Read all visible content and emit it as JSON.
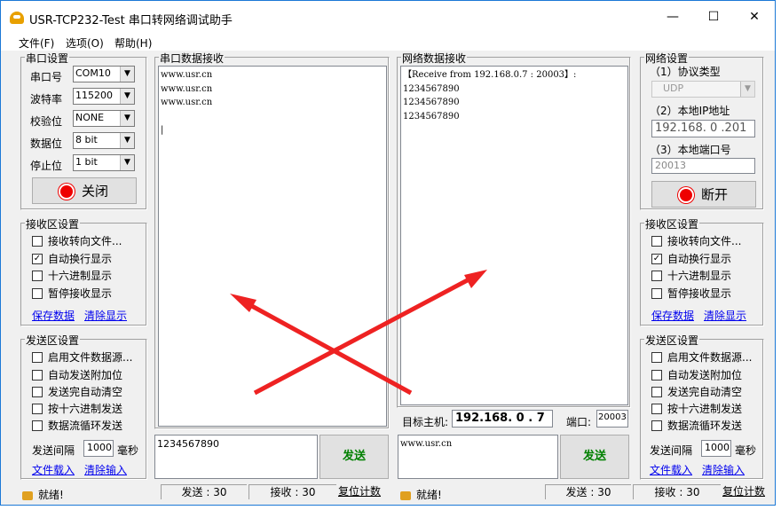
{
  "window": {
    "title": "USR-TCP232-Test 串口转网络调试助手",
    "minimize": "—",
    "maximize": "☐",
    "close": "✕"
  },
  "menu": [
    "文件(F)",
    "选项(O)",
    "帮助(H)"
  ],
  "serial": {
    "title": "串口设置",
    "port_label": "串口号",
    "port": "COM10",
    "baud_label": "波特率",
    "baud": "115200",
    "parity_label": "校验位",
    "parity": "NONE",
    "data_label": "数据位",
    "data": "8 bit",
    "stop_label": "停止位",
    "stop": "1 bit",
    "close_button": "关闭"
  },
  "net": {
    "title": "网络设置",
    "proto_label": "（1）协议类型",
    "proto": "UDP",
    "ip_label": "（2）本地IP地址",
    "ip": "192.168. 0 .201",
    "port_label": "（3）本地端口号",
    "port": "20013",
    "open_button": "断开"
  },
  "left_recv": {
    "title": "接收区设置",
    "opts": [
      "接收转向文件...",
      "自动换行显示",
      "十六进制显示",
      "暂停接收显示"
    ],
    "checked": [
      false,
      true,
      false,
      false
    ],
    "save": "保存数据",
    "clear": "清除显示"
  },
  "right_recv": {
    "title": "接收区设置",
    "opts": [
      "接收转向文件...",
      "自动换行显示",
      "十六进制显示",
      "暂停接收显示"
    ],
    "checked": [
      false,
      true,
      false,
      false
    ],
    "save": "保存数据",
    "clear": "清除显示"
  },
  "left_send": {
    "title": "发送区设置",
    "opts": [
      "启用文件数据源...",
      "自动发送附加位",
      "发送完自动清空",
      "按十六进制发送",
      "数据流循环发送"
    ],
    "interval_label": "发送间隔",
    "interval": "1000",
    "unit": "毫秒",
    "load": "文件载入",
    "clear": "清除输入"
  },
  "right_send": {
    "title": "发送区设置",
    "opts": [
      "启用文件数据源...",
      "自动发送附加位",
      "发送完自动清空",
      "按十六进制发送",
      "数据流循环发送"
    ],
    "interval_label": "发送间隔",
    "interval": "1000",
    "unit": "毫秒",
    "load": "文件载入",
    "clear": "清除输入"
  },
  "serial_recv": {
    "title": "串口数据接收",
    "content": "www.usr.cn\nwww.usr.cn\nwww.usr.cn\n\n|"
  },
  "net_recv": {
    "title": "网络数据接收",
    "content": "【Receive from 192.168.0.7 : 20003】:\n1234567890\n1234567890\n1234567890"
  },
  "target": {
    "host_label": "目标主机:",
    "host": "192.168. 0 . 7",
    "port_label": "端口:",
    "port": "20003"
  },
  "serial_send": {
    "content": "1234567890",
    "button": "发送"
  },
  "net_send": {
    "content": "www.usr.cn",
    "button": "发送"
  },
  "status_left": {
    "ready": "就绪!",
    "sent": "发送 : 30",
    "recv": "接收 : 30",
    "reset": "复位计数"
  },
  "status_right": {
    "ready": "就绪!",
    "sent": "发送 : 30",
    "recv": "接收 : 30",
    "reset": "复位计数"
  },
  "colors": {
    "arrow": "#ee2222",
    "accent": "#1b78d6",
    "send_text": "#008000"
  }
}
